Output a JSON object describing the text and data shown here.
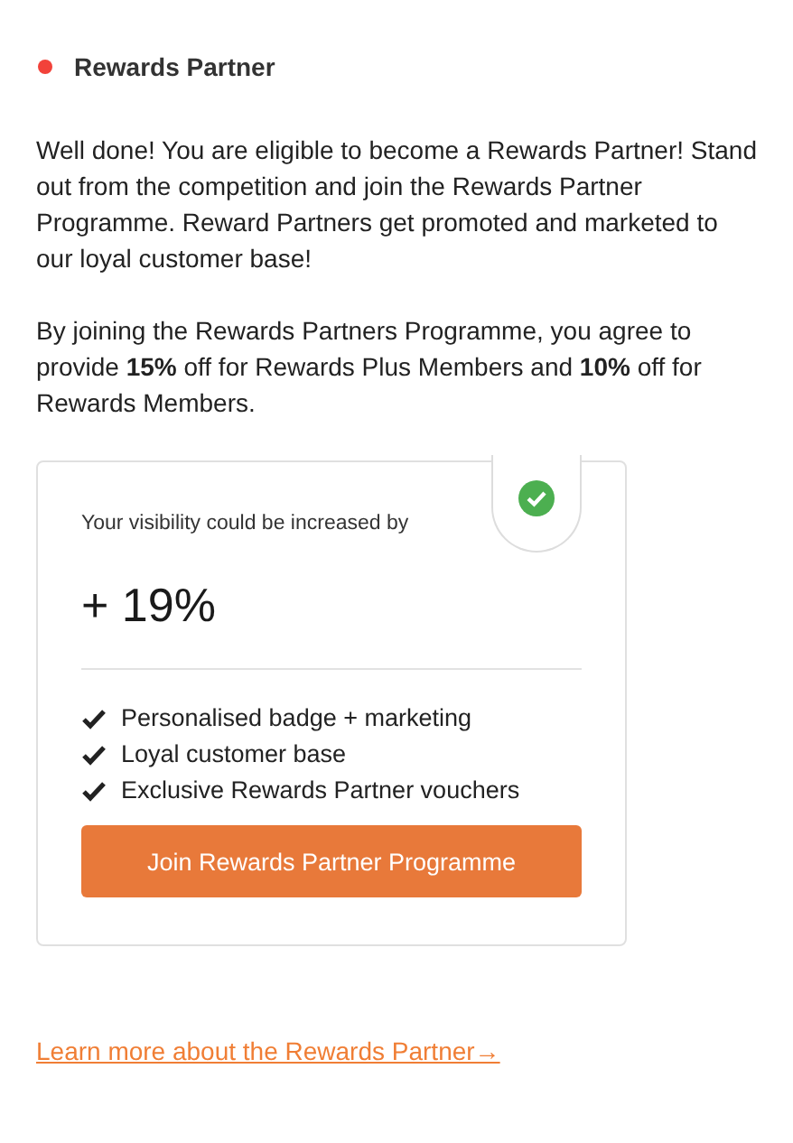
{
  "header": {
    "title": "Rewards Partner"
  },
  "paragraphs": [
    "Well done! You are eligible to become a Rewards Partner! Stand out from the competition and join the Rewards Partner Programme. Reward Partners get promoted and marketed to our loyal customer base!",
    "By joining the Rewards Partners Programme, you agree to provide **15%** off for Rewards Plus Members and **10%** off for Rewards Members."
  ],
  "card": {
    "caption": "Your visibility could be increased by",
    "value": "+ 19%",
    "benefits": [
      "Personalised badge + marketing",
      "Loyal customer base",
      "Exclusive Rewards Partner vouchers"
    ],
    "button": "Join Rewards Partner Programme"
  },
  "link": "Learn more about the Rewards Partner→"
}
